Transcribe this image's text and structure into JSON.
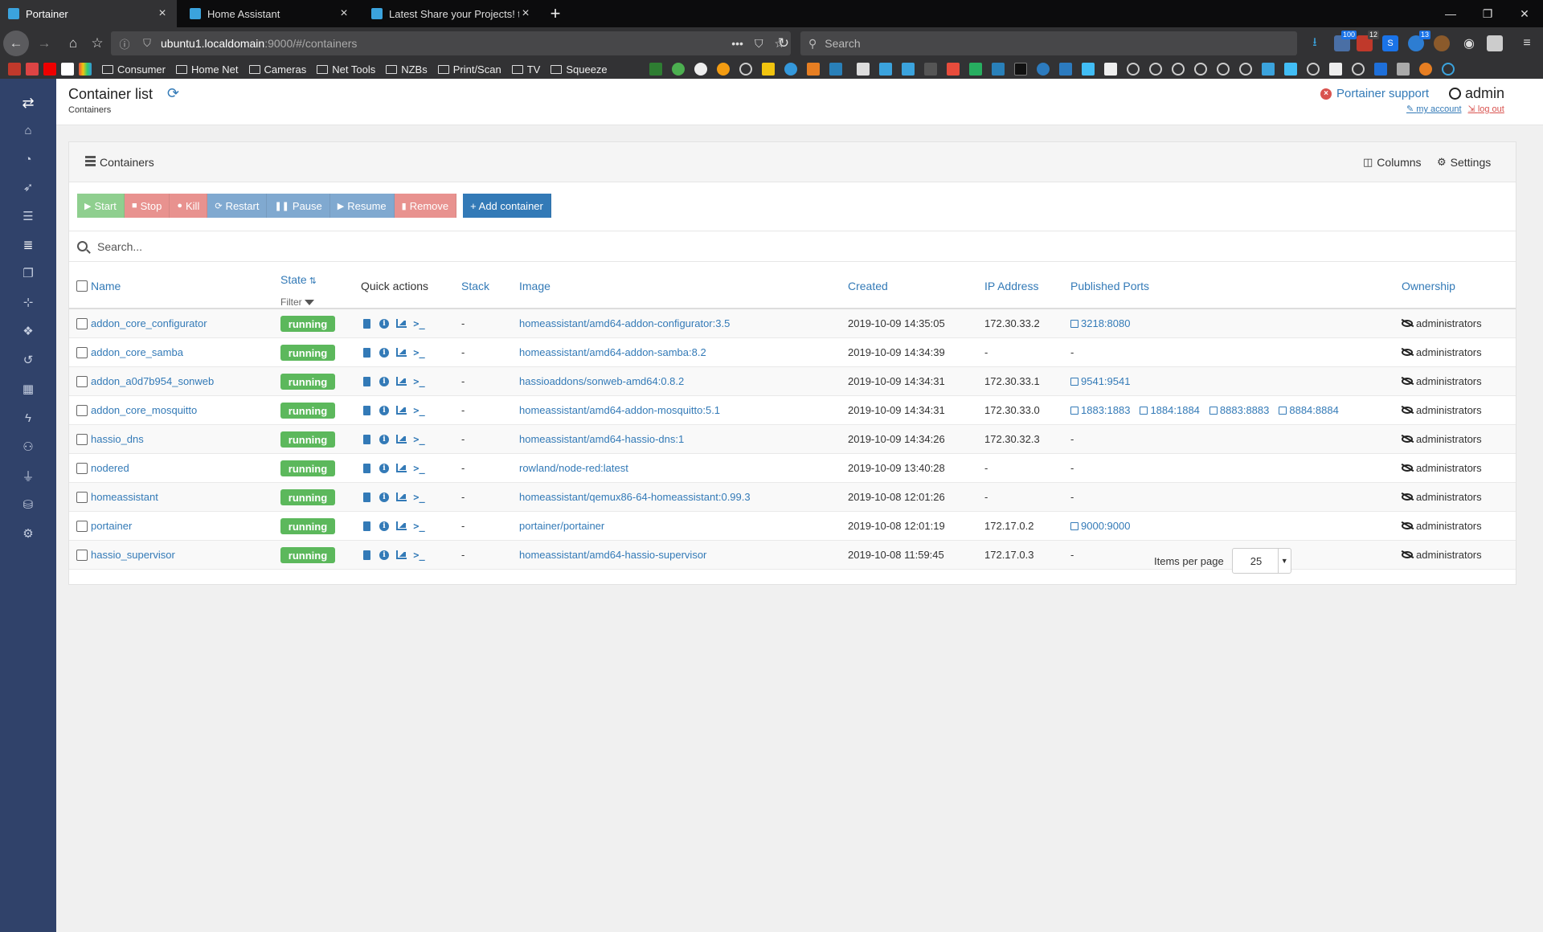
{
  "browser": {
    "tabs": [
      {
        "title": "Portainer",
        "active": true
      },
      {
        "title": "Home Assistant",
        "active": false
      },
      {
        "title": "Latest Share your Projects! topi",
        "active": false
      }
    ],
    "url_host": "ubuntu1.localdomain",
    "url_rest": ":9000/#/containers",
    "search_placeholder": "Search",
    "ext_badges": [
      "100",
      "12",
      "13"
    ],
    "bookmark_folders": [
      "Consumer",
      "Home Net",
      "Cameras",
      "Net Tools",
      "NZBs",
      "Print/Scan",
      "TV",
      "Squeeze"
    ]
  },
  "sidebar": {
    "icons": [
      "exchange-icon",
      "home-icon",
      "dashboard-icon",
      "rocket-icon",
      "th-list-icon",
      "containers-icon",
      "clone-icon",
      "sitemap-icon",
      "cubes-icon",
      "history-icon",
      "apps-icon",
      "bolt-icon",
      "users-icon",
      "plug-icon",
      "database-icon",
      "cogs-icon"
    ],
    "active_index": 5
  },
  "header": {
    "title": "Container list",
    "breadcrumb": "Containers",
    "support": "Portainer support",
    "user": "admin",
    "my_account": "my account",
    "log_out": "log out"
  },
  "widget": {
    "title": "Containers",
    "columns_label": "Columns",
    "settings_label": "Settings",
    "actions": {
      "start": "Start",
      "stop": "Stop",
      "kill": "Kill",
      "restart": "Restart",
      "pause": "Pause",
      "resume": "Resume",
      "remove": "Remove",
      "add": "+ Add container"
    },
    "search_placeholder": "Search...",
    "columns": {
      "name": "Name",
      "state": "State",
      "filter": "Filter",
      "quick_actions": "Quick actions",
      "stack": "Stack",
      "image": "Image",
      "created": "Created",
      "ip": "IP Address",
      "ports": "Published Ports",
      "ownership": "Ownership"
    },
    "rows": [
      {
        "name": "addon_core_configurator",
        "state": "running",
        "stack": "-",
        "image": "homeassistant/amd64-addon-configurator:3.5",
        "created": "2019-10-09 14:35:05",
        "ip": "172.30.33.2",
        "ports": [
          "3218:8080"
        ],
        "ownership": "administrators"
      },
      {
        "name": "addon_core_samba",
        "state": "running",
        "stack": "-",
        "image": "homeassistant/amd64-addon-samba:8.2",
        "created": "2019-10-09 14:34:39",
        "ip": "-",
        "ports": [],
        "ownership": "administrators"
      },
      {
        "name": "addon_a0d7b954_sonweb",
        "state": "running",
        "stack": "-",
        "image": "hassioaddons/sonweb-amd64:0.8.2",
        "created": "2019-10-09 14:34:31",
        "ip": "172.30.33.1",
        "ports": [
          "9541:9541"
        ],
        "ownership": "administrators"
      },
      {
        "name": "addon_core_mosquitto",
        "state": "running",
        "stack": "-",
        "image": "homeassistant/amd64-addon-mosquitto:5.1",
        "created": "2019-10-09 14:34:31",
        "ip": "172.30.33.0",
        "ports": [
          "1883:1883",
          "1884:1884",
          "8883:8883",
          "8884:8884"
        ],
        "ownership": "administrators"
      },
      {
        "name": "hassio_dns",
        "state": "running",
        "stack": "-",
        "image": "homeassistant/amd64-hassio-dns:1",
        "created": "2019-10-09 14:34:26",
        "ip": "172.30.32.3",
        "ports": [],
        "ownership": "administrators"
      },
      {
        "name": "nodered",
        "state": "running",
        "stack": "-",
        "image": "rowland/node-red:latest",
        "created": "2019-10-09 13:40:28",
        "ip": "-",
        "ports": [],
        "ownership": "administrators"
      },
      {
        "name": "homeassistant",
        "state": "running",
        "stack": "-",
        "image": "homeassistant/qemux86-64-homeassistant:0.99.3",
        "created": "2019-10-08 12:01:26",
        "ip": "-",
        "ports": [],
        "ownership": "administrators"
      },
      {
        "name": "portainer",
        "state": "running",
        "stack": "-",
        "image": "portainer/portainer",
        "created": "2019-10-08 12:01:19",
        "ip": "172.17.0.2",
        "ports": [
          "9000:9000"
        ],
        "ownership": "administrators"
      },
      {
        "name": "hassio_supervisor",
        "state": "running",
        "stack": "-",
        "image": "homeassistant/amd64-hassio-supervisor",
        "created": "2019-10-08 11:59:45",
        "ip": "172.17.0.3",
        "ports": [],
        "ownership": "administrators"
      }
    ],
    "empty_ports": "-",
    "items_per_page_label": "Items per page",
    "items_per_page": "25"
  }
}
